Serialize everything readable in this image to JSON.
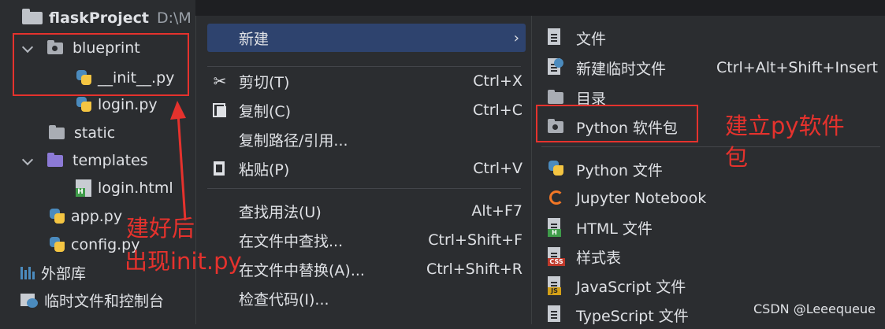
{
  "project": {
    "name": "flaskProject",
    "path": "D:\\M"
  },
  "tree": [
    {
      "label": "blueprint",
      "kind": "folder"
    },
    {
      "label": "__init__.py",
      "kind": "py"
    },
    {
      "label": "login.py",
      "kind": "py"
    },
    {
      "label": "static",
      "kind": "folder"
    },
    {
      "label": "templates",
      "kind": "folder-purple"
    },
    {
      "label": "login.html",
      "kind": "html"
    },
    {
      "label": "app.py",
      "kind": "py"
    },
    {
      "label": "config.py",
      "kind": "py"
    },
    {
      "label": "外部库",
      "kind": "libraries"
    },
    {
      "label": "临时文件和控制台",
      "kind": "scratches"
    }
  ],
  "context_menu": {
    "items": [
      {
        "label": "新建",
        "shortcut": "",
        "icon": ""
      },
      {
        "label": "剪切(T)",
        "shortcut": "Ctrl+X",
        "icon": "scissors-icon"
      },
      {
        "label": "复制(C)",
        "shortcut": "Ctrl+C",
        "icon": "copy-icon"
      },
      {
        "label": "复制路径/引用...",
        "shortcut": "",
        "icon": ""
      },
      {
        "label": "粘贴(P)",
        "shortcut": "Ctrl+V",
        "icon": "paste-icon"
      },
      {
        "label": "查找用法(U)",
        "shortcut": "Alt+F7",
        "icon": ""
      },
      {
        "label": "在文件中查找...",
        "shortcut": "Ctrl+Shift+F",
        "icon": ""
      },
      {
        "label": "在文件中替换(A)...",
        "shortcut": "Ctrl+Shift+R",
        "icon": ""
      },
      {
        "label": "检查代码(I)...",
        "shortcut": "",
        "icon": ""
      }
    ]
  },
  "submenu": {
    "items": [
      {
        "label": "文件",
        "shortcut": ""
      },
      {
        "label": "新建临时文件",
        "shortcut": "Ctrl+Alt+Shift+Insert"
      },
      {
        "label": "目录",
        "shortcut": ""
      },
      {
        "label": "Python 软件包",
        "shortcut": ""
      },
      {
        "label": "Python 文件",
        "shortcut": ""
      },
      {
        "label": "Jupyter Notebook",
        "shortcut": ""
      },
      {
        "label": "HTML 文件",
        "shortcut": ""
      },
      {
        "label": "样式表",
        "shortcut": ""
      },
      {
        "label": "JavaScript 文件",
        "shortcut": ""
      },
      {
        "label": "TypeScript 文件",
        "shortcut": ""
      }
    ]
  },
  "annotations": {
    "after_build": "建好后",
    "init_appears": "出现init.py",
    "create_package": "建立py软件",
    "create_package_2": "包"
  },
  "badges": {
    "html": "H",
    "css": "CSS",
    "js": "JS"
  },
  "watermark": "CSDN @Leeequeue",
  "colors": {
    "accent": "#2e436e",
    "annotation_red": "#e5322d",
    "background": "#2b2d30"
  }
}
